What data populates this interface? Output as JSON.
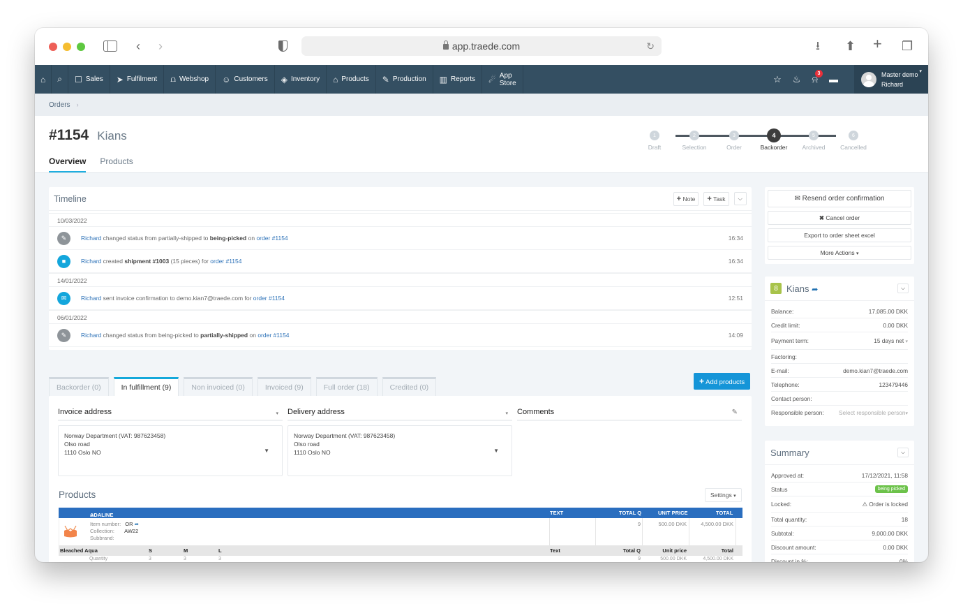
{
  "browser": {
    "url": "app.traede.com"
  },
  "nav": {
    "items": [
      {
        "label": "Sales",
        "icon": "file-icon"
      },
      {
        "label": "Fulfilment",
        "icon": "paper-plane-icon"
      },
      {
        "label": "Webshop",
        "icon": "cart-icon"
      },
      {
        "label": "Customers",
        "icon": "users-icon"
      },
      {
        "label": "Inventory",
        "icon": "layers-icon"
      },
      {
        "label": "Products",
        "icon": "shirt-icon"
      },
      {
        "label": "Production",
        "icon": "pencil-icon"
      },
      {
        "label": "Reports",
        "icon": "chart-icon"
      }
    ],
    "app_store_line1": "App",
    "app_store_line2": "Store",
    "notification_count": "3",
    "user_line1": "Master demo",
    "user_line2": "Richard"
  },
  "breadcrumb": {
    "root": "Orders"
  },
  "header": {
    "order_number": "#1154",
    "customer": "Kians",
    "tabs": [
      "Overview",
      "Products"
    ],
    "active_tab": "Overview"
  },
  "stepper": {
    "steps": [
      {
        "num": "1",
        "label": "Draft"
      },
      {
        "num": "2",
        "label": "Selection"
      },
      {
        "num": "3",
        "label": "Order"
      },
      {
        "num": "4",
        "label": "Backorder"
      },
      {
        "num": "5",
        "label": "Archived"
      },
      {
        "num": "6",
        "label": "Cancelled"
      }
    ],
    "active": "Backorder"
  },
  "timeline": {
    "title": "Timeline",
    "note_label": "Note",
    "task_label": "Task",
    "groups": [
      {
        "date": "10/03/2022",
        "entries": [
          {
            "icon": "pencil-icon",
            "user": "Richard",
            "pre": "changed status from partially-shipped to",
            "bold": "being-picked",
            "mid": "on",
            "link": "order #1154",
            "time": "16:34"
          },
          {
            "icon": "truck-icon",
            "user": "Richard",
            "pre": "created",
            "bold": "shipment #1003",
            "mid": "(15 pieces) for",
            "link": "order #1154",
            "time": "16:34"
          }
        ]
      },
      {
        "date": "14/01/2022",
        "entries": [
          {
            "icon": "envelope-icon",
            "user": "Richard",
            "pre": "sent invoice confirmation to demo.kian7@traede.com for",
            "bold": "",
            "mid": "",
            "link": "order #1154",
            "time": "12:51"
          }
        ]
      },
      {
        "date": "06/01/2022",
        "entries": [
          {
            "icon": "pencil-icon",
            "user": "Richard",
            "pre": "changed status from being-picked to",
            "bold": "partially-shipped",
            "mid": "on",
            "link": "order #1154",
            "time": "14:09"
          }
        ]
      }
    ]
  },
  "actions": {
    "resend": "Resend order confirmation",
    "cancel": "Cancel order",
    "export": "Export to order sheet excel",
    "more": "More Actions"
  },
  "customer": {
    "badge": "8",
    "name": "Kians",
    "fields": [
      {
        "label": "Balance:",
        "value": "17,085.00 DKK"
      },
      {
        "label": "Credit limit:",
        "value": "0.00 DKK"
      },
      {
        "label": "Payment term:",
        "value": "15 days net"
      },
      {
        "label": "Factoring:",
        "value": ""
      },
      {
        "label": "E-mail:",
        "value": "demo.kian7@traede.com"
      },
      {
        "label": "Telephone:",
        "value": "123479446"
      },
      {
        "label": "Contact person:",
        "value": ""
      },
      {
        "label": "Responsible person:",
        "value": "Select responsible person"
      }
    ]
  },
  "summary": {
    "title": "Summary",
    "fields": [
      {
        "label": "Approved at:",
        "value": "17/12/2021, 11:58"
      },
      {
        "label": "Status",
        "value": "being picked"
      },
      {
        "label": "Locked:",
        "value": "Order is locked"
      },
      {
        "label": "Total quantity:",
        "value": "18"
      },
      {
        "label": "Subtotal:",
        "value": "9,000.00 DKK"
      },
      {
        "label": "Discount amount:",
        "value": "0.00 DKK"
      },
      {
        "label": "Discount in %:",
        "value": "0%"
      }
    ]
  },
  "sub_tabs": {
    "items": [
      "Backorder (0)",
      "In fulfillment (9)",
      "Non invoiced (0)",
      "Invoiced (9)",
      "Full order (18)",
      "Credited (0)"
    ],
    "active": "In fulfillment (9)",
    "add_products": "Add products"
  },
  "addresses": {
    "invoice_title": "Invoice address",
    "delivery_title": "Delivery address",
    "comments_title": "Comments",
    "invoice": [
      "Norway Department (VAT: 987623458)",
      "Olso road",
      "1110 Oslo NO"
    ],
    "delivery": [
      "Norway Department (VAT: 987623458)",
      "Olso road",
      "1110 Oslo NO"
    ]
  },
  "products": {
    "title": "Products",
    "settings_label": "Settings",
    "header": {
      "name": "ADALINE",
      "text": "TEXT",
      "total_q": "TOTAL Q",
      "unit_price": "UNIT PRICE",
      "total": "TOTAL"
    },
    "item": {
      "item_number_label": "Item number:",
      "item_number": "OR",
      "collection_label": "Collection:",
      "collection": "AW22",
      "subbrand_label": "Subbrand:",
      "total_q": "9",
      "unit_price": "500.00 DKK",
      "total": "4,500.00 DKK"
    },
    "variant_header": {
      "color": "Bleached Aqua",
      "sizes": [
        "S",
        "M",
        "L"
      ],
      "text": "Text",
      "total_q": "Total Q",
      "unit_price": "Unit price",
      "total": "Total"
    },
    "variant_row": {
      "label": "Quantity",
      "sizes": [
        "3",
        "3",
        "3"
      ],
      "total_q": "9",
      "unit_price": "500.00 DKK",
      "total": "4,500.00 DKK"
    }
  }
}
